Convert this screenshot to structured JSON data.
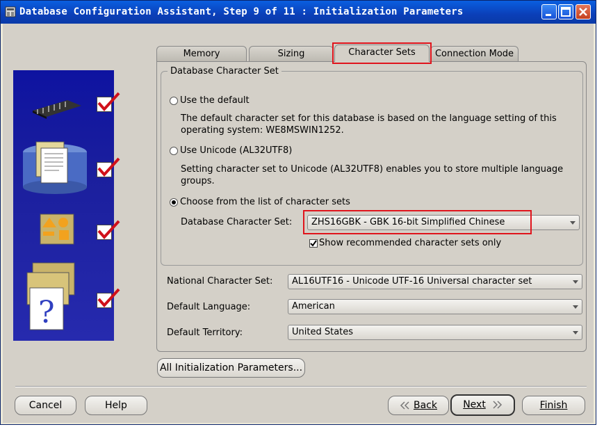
{
  "window": {
    "title": "Database Configuration Assistant, Step 9 of 11 : Initialization Parameters"
  },
  "tabs": [
    {
      "label": "Memory"
    },
    {
      "label": "Sizing"
    },
    {
      "label": "Character Sets",
      "selected": true
    },
    {
      "label": "Connection Mode"
    }
  ],
  "db_charset_group": {
    "title": "Database Character Set",
    "options": [
      {
        "label": "Use the default",
        "description": "The default character set for this database is based on the language setting of this operating system: WE8MSWIN1252.",
        "selected": false
      },
      {
        "label": "Use Unicode (AL32UTF8)",
        "description": "Setting character set to Unicode (AL32UTF8) enables you to store multiple language groups.",
        "selected": false
      },
      {
        "label": "Choose from the list of character sets",
        "selected": true
      }
    ],
    "charset_label": "Database Character Set:",
    "charset_value": "ZHS16GBK - GBK 16-bit Simplified Chinese",
    "recommended_label": "Show recommended character sets only",
    "recommended_checked": true
  },
  "national_charset": {
    "label": "National Character Set:",
    "value": "AL16UTF16 - Unicode UTF-16 Universal character set"
  },
  "default_language": {
    "label": "Default Language:",
    "value": "American"
  },
  "default_territory": {
    "label": "Default Territory:",
    "value": "United States"
  },
  "all_params_button": "All Initialization Parameters...",
  "buttons": {
    "cancel": "Cancel",
    "help": "Help",
    "back": "Back",
    "next": "Next",
    "finish": "Finish"
  },
  "colors": {
    "highlight": "#E0141C",
    "titlebar": "#0B3FB8",
    "side_panel": "#1B1F9D"
  },
  "icons": {
    "back": "double-chevron-left",
    "next": "double-chevron-right"
  }
}
